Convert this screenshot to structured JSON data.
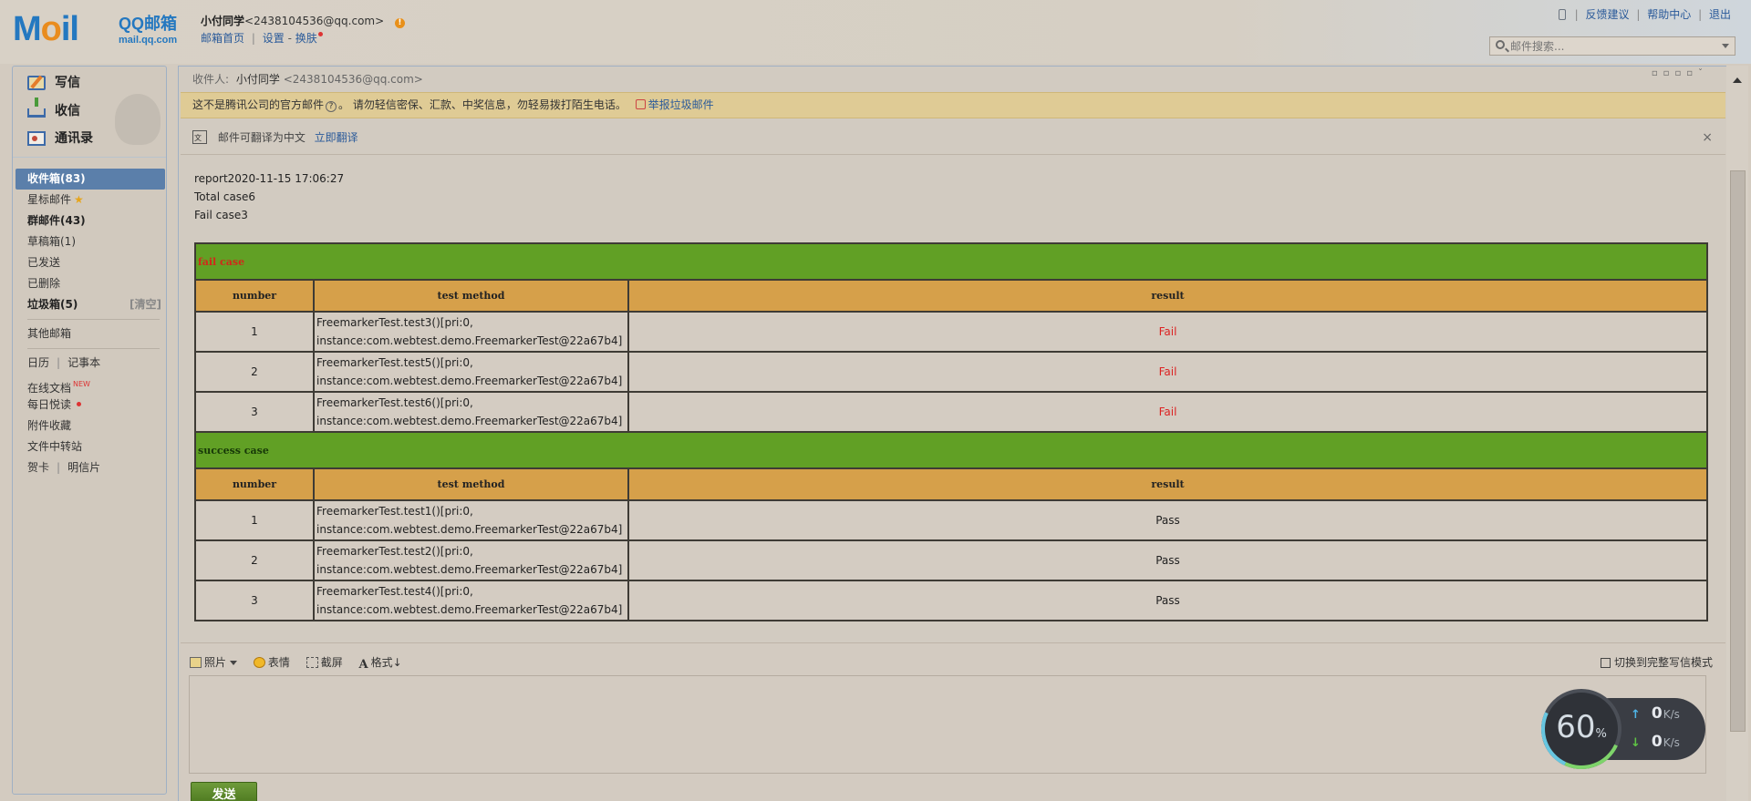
{
  "logo": {
    "moil_left": "M",
    "moil_o": "o",
    "moil_right": "il",
    "qq_title": "QQ邮箱",
    "domain": "mail.qq.com"
  },
  "user": {
    "name": "小付同学",
    "address": "<2438104536@qq.com>",
    "warn_icon": "!"
  },
  "user_links": {
    "home": "邮箱首页",
    "sep": "|",
    "settings": "设置",
    "dash": "-",
    "skin": "换肤"
  },
  "top_links": {
    "feedback": "反馈建议",
    "help": "帮助中心",
    "logout": "退出",
    "sep": "|"
  },
  "search": {
    "placeholder": "邮件搜索..."
  },
  "actions": {
    "write": "写信",
    "inbox": "收信",
    "contacts": "通讯录"
  },
  "folders": {
    "inbox": "收件箱(83)",
    "starred": "星标邮件",
    "star_icon": "★",
    "group": "群邮件(43)",
    "drafts": "草稿箱(1)",
    "sent": "已发送",
    "deleted": "已删除",
    "spam": "垃圾箱(5)",
    "spam_clear": "[清空]",
    "other": "其他邮箱",
    "calendar": "日历",
    "notepad": "记事本",
    "online_docs": "在线文档",
    "new_badge": "NEW",
    "daily_read": "每日悦读",
    "attachments": "附件收藏",
    "file_transfer": "文件中转站",
    "cards": "贺卡",
    "postcards": "明信片",
    "sep": "|"
  },
  "mail": {
    "recipient_label": "收件人:",
    "recipient_name": "小付同学",
    "recipient_addr": "<2438104536@qq.com>",
    "warning_text": "这不是腾讯公司的官方邮件",
    "warning_q": "?",
    "warning_tail": "。  请勿轻信密保、汇款、中奖信息，勿轻易拨打陌生电话。",
    "report_spam": "举报垃圾邮件",
    "translate_text": "邮件可翻译为中文",
    "translate_link": "立即翻译",
    "close": "×",
    "body_lines": [
      "report2020-11-15 17:06:27",
      "Total case6",
      "Fail case3"
    ]
  },
  "report": {
    "fail_title": "fail case",
    "success_title": "success case",
    "headers": {
      "number": "number",
      "method": "test method",
      "result": "result"
    },
    "fail_rows": [
      {
        "number": "1",
        "method_line1": "FreemarkerTest.test3()[pri:0,",
        "method_line2": "instance:com.webtest.demo.FreemarkerTest@22a67b4]",
        "result": "Fail"
      },
      {
        "number": "2",
        "method_line1": "FreemarkerTest.test5()[pri:0,",
        "method_line2": "instance:com.webtest.demo.FreemarkerTest@22a67b4]",
        "result": "Fail"
      },
      {
        "number": "3",
        "method_line1": "FreemarkerTest.test6()[pri:0,",
        "method_line2": "instance:com.webtest.demo.FreemarkerTest@22a67b4]",
        "result": "Fail"
      }
    ],
    "success_rows": [
      {
        "number": "1",
        "method_line1": "FreemarkerTest.test1()[pri:0,",
        "method_line2": "instance:com.webtest.demo.FreemarkerTest@22a67b4]",
        "result": "Pass"
      },
      {
        "number": "2",
        "method_line1": "FreemarkerTest.test2()[pri:0,",
        "method_line2": "instance:com.webtest.demo.FreemarkerTest@22a67b4]",
        "result": "Pass"
      },
      {
        "number": "3",
        "method_line1": "FreemarkerTest.test4()[pri:0,",
        "method_line2": "instance:com.webtest.demo.FreemarkerTest@22a67b4]",
        "result": "Pass"
      }
    ]
  },
  "composer": {
    "photo": "照片",
    "emoji": "表情",
    "screenshot": "截屏",
    "format": "格式",
    "format_icon": "A",
    "format_arrow": "↓",
    "switch_mode": "切换到完整写信模式",
    "send": "发送"
  },
  "speed_widget": {
    "percent": "60",
    "percent_sign": "%",
    "upload": "0",
    "download": "0",
    "unit": "K/s",
    "up_arrow": "↑",
    "down_arrow": "↓"
  },
  "colors": {
    "section_green": "#61a025",
    "header_orange": "#d6a04a",
    "fail_red": "#d22",
    "warn_bar": "#dfcb95"
  }
}
